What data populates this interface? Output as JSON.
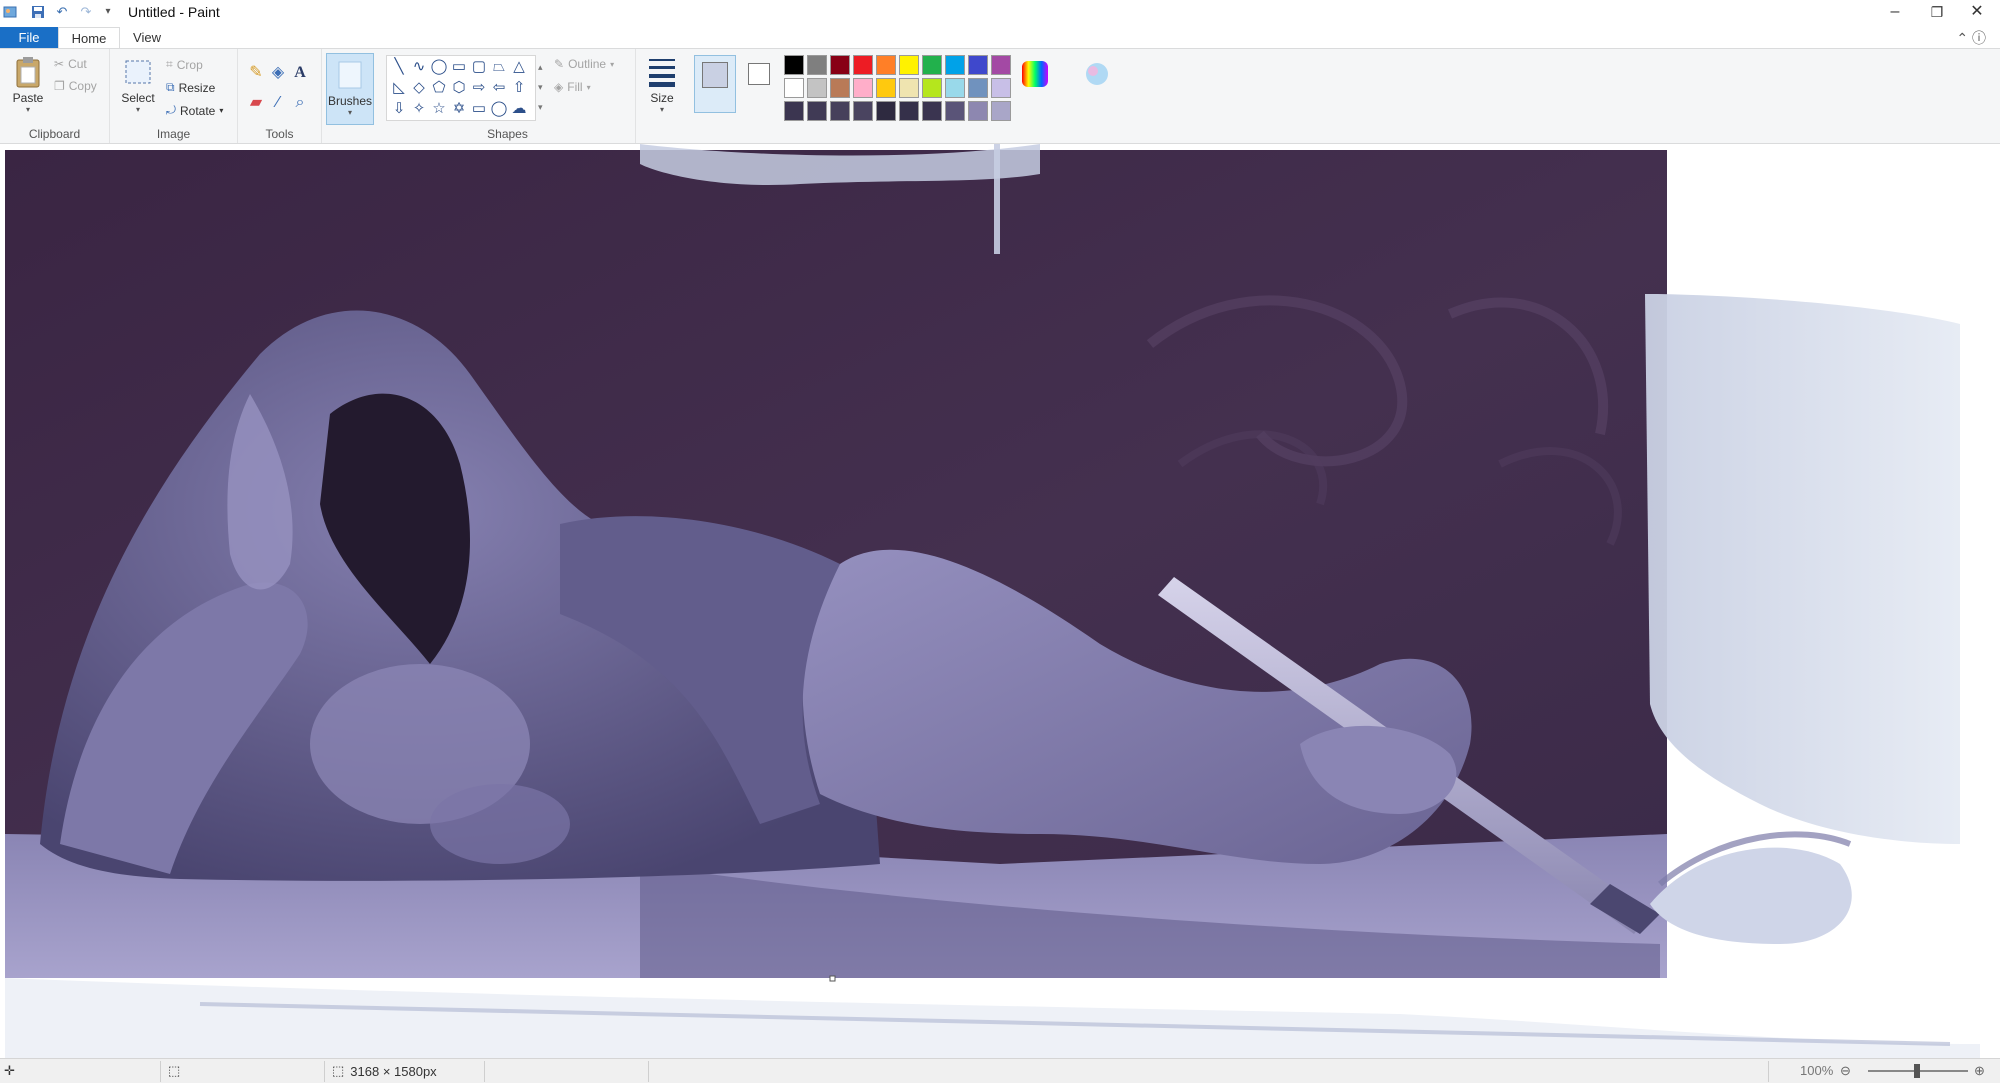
{
  "window": {
    "title": "Untitled - Paint",
    "controls": {
      "minimize": "–",
      "maximize": "❐",
      "close": "✕"
    }
  },
  "quick_access": {
    "icons": [
      "paint-app-icon",
      "save-icon",
      "undo-icon",
      "redo-icon",
      "customize-dropdown-icon"
    ]
  },
  "tabs": {
    "file": "File",
    "home": "Home",
    "view": "View"
  },
  "ribbon": {
    "clipboard": {
      "label": "Clipboard",
      "paste": "Paste",
      "cut": "Cut",
      "copy": "Copy"
    },
    "image": {
      "label": "Image",
      "select": "Select",
      "crop": "Crop",
      "resize": "Resize",
      "rotate": "Rotate"
    },
    "tools": {
      "label": "Tools"
    },
    "brushes": {
      "label": "Brushes"
    },
    "shapes": {
      "label": "Shapes",
      "outline": "Outline",
      "fill": "Fill"
    },
    "size": {
      "label": "Size"
    },
    "colors": {
      "row1": [
        "#000000",
        "#7f7f7f",
        "#880015",
        "#ed1c24",
        "#ff7f27",
        "#fff200",
        "#22b14c",
        "#00a2e8",
        "#3f48cc",
        "#a349a4"
      ],
      "row2": [
        "#ffffff",
        "#c3c3c3",
        "#b97a57",
        "#ffaec9",
        "#ffc90e",
        "#efe4b0",
        "#b5e61d",
        "#99d9ea",
        "#7092be",
        "#c8bfe7"
      ],
      "row3": [
        "#3b3550",
        "#403a55",
        "#46405b",
        "#4a4460",
        "#2e2a40",
        "#35304a",
        "#3a3450",
        "#5a5478",
        "#8d87b0",
        "#a9a6c8"
      ]
    }
  },
  "canvas": {
    "background": "#3e2a4a",
    "figure_color": "#6f6a98",
    "floor_color": "#a39fc8",
    "overpaint_color": "#c9d0e3"
  },
  "status": {
    "dimensions": "3168 × 1580px",
    "zoom": "100%"
  }
}
